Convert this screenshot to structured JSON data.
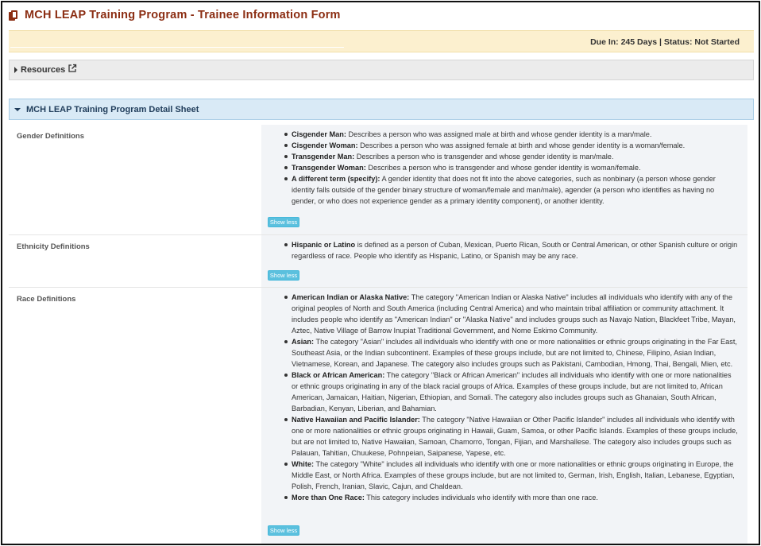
{
  "header": {
    "title": "MCH LEAP Training Program - Trainee Information Form"
  },
  "status_bar": {
    "text": "Due In: 245 Days | Status: Not Started"
  },
  "resources": {
    "label": "Resources"
  },
  "section": {
    "label": "MCH LEAP Training Program Detail Sheet"
  },
  "rows": {
    "gender": {
      "label": "Gender Definitions",
      "button": "Show less",
      "items": [
        {
          "term": "Cisgender Man:",
          "desc": " Describes a person who was assigned male at birth and whose gender identity is a man/male."
        },
        {
          "term": "Cisgender Woman:",
          "desc": " Describes a person who was assigned female at birth and whose gender identity is a woman/female."
        },
        {
          "term": "Transgender Man:",
          "desc": " Describes a person who is transgender and whose gender identity is man/male."
        },
        {
          "term": "Transgender Woman:",
          "desc": " Describes a person who is transgender and whose gender identity is woman/female."
        },
        {
          "term": "A different term (specify):",
          "desc": " A gender identity that does not fit into the above categories, such as nonbinary (a person whose gender identity falls outside of the gender binary structure of woman/female and man/male), agender (a person who identifies as having no gender, or who does not experience gender as a primary identity component), or another identity."
        }
      ]
    },
    "ethnicity": {
      "label": "Ethnicity Definitions",
      "button": "Show less",
      "items": [
        {
          "term": "Hispanic or Latino",
          "desc": " is defined as a person of Cuban, Mexican, Puerto Rican, South or Central American, or other Spanish culture or origin regardless of race. People who identify as Hispanic, Latino, or Spanish may be any race."
        }
      ]
    },
    "race": {
      "label": "Race Definitions",
      "button": "Show less",
      "items": [
        {
          "term": "American Indian or Alaska Native:",
          "desc": " The category \"American Indian or Alaska Native\" includes all individuals who identify with any of the original peoples of North and South America (including Central America) and who maintain tribal affiliation or community attachment. It includes people who identify as \"American Indian\" or \"Alaska Native\" and includes groups such as Navajo Nation, Blackfeet Tribe, Mayan, Aztec, Native Village of Barrow Inupiat Traditional Government, and Nome Eskimo Community."
        },
        {
          "term": "Asian:",
          "desc": " The category \"Asian\" includes all individuals who identify with one or more nationalities or ethnic groups originating in the Far East, Southeast Asia, or the Indian subcontinent. Examples of these groups include, but are not limited to, Chinese, Filipino, Asian Indian, Vietnamese, Korean, and Japanese. The category also includes groups such as Pakistani, Cambodian, Hmong, Thai, Bengali, Mien, etc."
        },
        {
          "term": "Black or African American:",
          "desc": " The category \"Black or African American\" includes all individuals who identify with one or more nationalities or ethnic groups originating in any of the black racial groups of Africa. Examples of these groups include, but are not limited to, African American, Jamaican, Haitian, Nigerian, Ethiopian, and Somali. The category also includes groups such as Ghanaian, South African, Barbadian, Kenyan, Liberian, and Bahamian."
        },
        {
          "term": "Native Hawaiian and Pacific Islander:",
          "desc": " The category \"Native Hawaiian or Other Pacific Islander\" includes all individuals who identify with one or more nationalities or ethnic groups originating in Hawaii, Guam, Samoa, or other Pacific Islands. Examples of these groups include, but are not limited to, Native Hawaiian, Samoan, Chamorro, Tongan, Fijian, and Marshallese. The category also includes groups such as Palauan, Tahitian, Chuukese, Pohnpeian, Saipanese, Yapese, etc."
        },
        {
          "term": "White:",
          "desc": " The category \"White\" includes all individuals who identify with one or more nationalities or ethnic groups originating in Europe, the Middle East, or North Africa. Examples of these groups include, but are not limited to, German, Irish, English, Italian, Lebanese, Egyptian, Polish, French, Iranian, Slavic, Cajun, and Chaldean."
        },
        {
          "term": "More than One Race:",
          "desc": " This category includes individuals who identify with more than one race."
        }
      ]
    }
  }
}
